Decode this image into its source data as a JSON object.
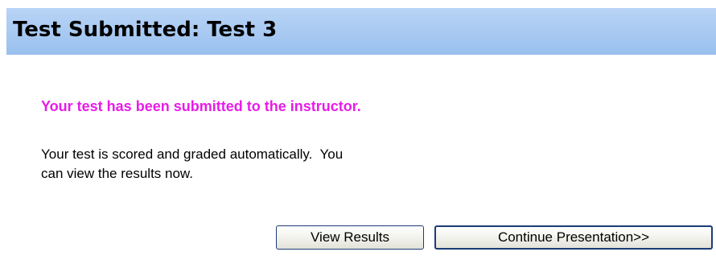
{
  "header": {
    "title": "Test Submitted: Test 3"
  },
  "main": {
    "confirmation": "Your test has been submitted to the instructor.",
    "info_line_1": "Your test is scored and graded automatically.  You",
    "info_line_2": "can view the results now."
  },
  "actions": {
    "view_results_label": "View Results",
    "continue_label": "Continue Presentation>>"
  },
  "colors": {
    "title_bar": "#a8caf2",
    "confirmation_text": "#e81ce8",
    "button_border": "#1c3c78"
  }
}
